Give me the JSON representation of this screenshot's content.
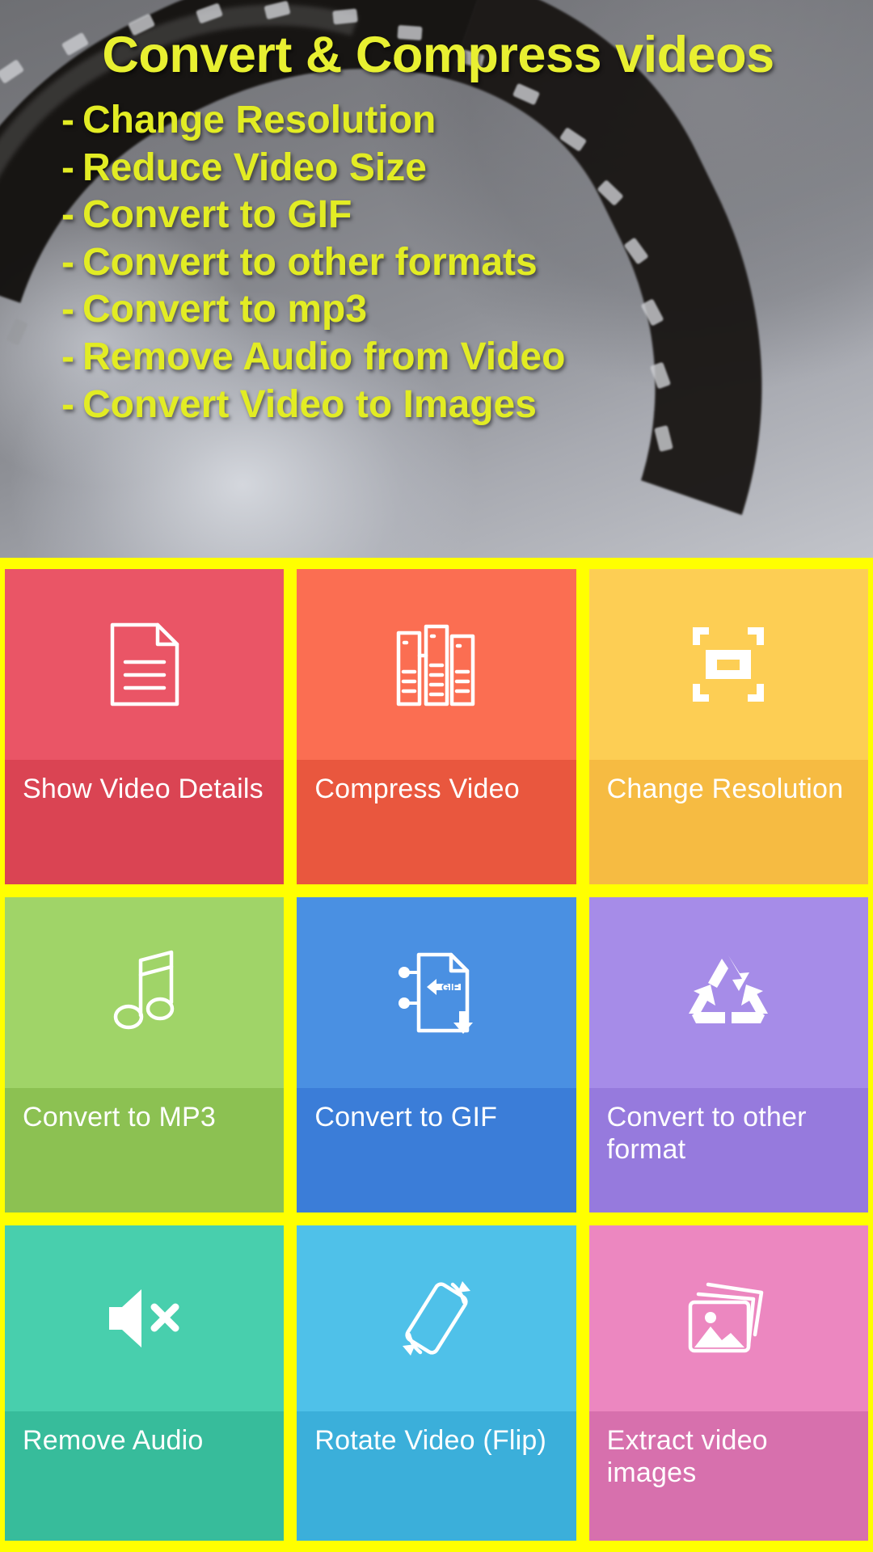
{
  "hero": {
    "title": "Convert & Compress videos",
    "bullets": [
      "Change Resolution",
      "Reduce Video Size",
      "Convert to GIF",
      "Convert to other formats",
      "Convert to mp3",
      "Remove Audio from Video",
      "Convert Video to Images"
    ],
    "bullet_marker": "-",
    "text_color": "#e5ee2a",
    "background_color": "#7b7b7d"
  },
  "grid": {
    "border_color": "#ffff00",
    "rows": [
      {
        "tiles": [
          {
            "label": "Show Video Details",
            "icon": "document-lines-icon",
            "icon_color": "#ffffff",
            "top_color": "#ea5566",
            "bottom_color": "#da4453"
          },
          {
            "label": "Compress Video",
            "icon": "books-shelf-icon",
            "icon_color": "#ffffff",
            "top_color": "#fb6e52",
            "bottom_color": "#e9573e"
          },
          {
            "label": "Change Resolution",
            "icon": "crop-frame-icon",
            "icon_color": "#ffffff",
            "top_color": "#fdce54",
            "bottom_color": "#f6bb42"
          }
        ]
      },
      {
        "tiles": [
          {
            "label": "Convert to MP3",
            "icon": "music-note-icon",
            "icon_color": "#ffffff",
            "top_color": "#a0d468",
            "bottom_color": "#8cc152"
          },
          {
            "label": "Convert to GIF",
            "icon": "gif-file-download-icon",
            "icon_color": "#ffffff",
            "top_color": "#4a90e2",
            "bottom_color": "#3b7dd8"
          },
          {
            "label": "Convert to other format",
            "icon": "recycle-icon",
            "icon_color": "#ffffff",
            "top_color": "#a68ce8",
            "bottom_color": "#967add"
          }
        ]
      },
      {
        "tiles": [
          {
            "label": "Remove Audio",
            "icon": "speaker-mute-icon",
            "icon_color": "#ffffff",
            "top_color": "#48cfad",
            "bottom_color": "#37bc9b"
          },
          {
            "label": "Rotate Video (Flip)",
            "icon": "rotate-device-icon",
            "icon_color": "#ffffff",
            "top_color": "#4fc1e9",
            "bottom_color": "#3bafda"
          },
          {
            "label": "Extract video images",
            "icon": "photos-stack-icon",
            "icon_color": "#ffffff",
            "top_color": "#ec87c0",
            "bottom_color": "#d770ad"
          }
        ]
      }
    ]
  }
}
